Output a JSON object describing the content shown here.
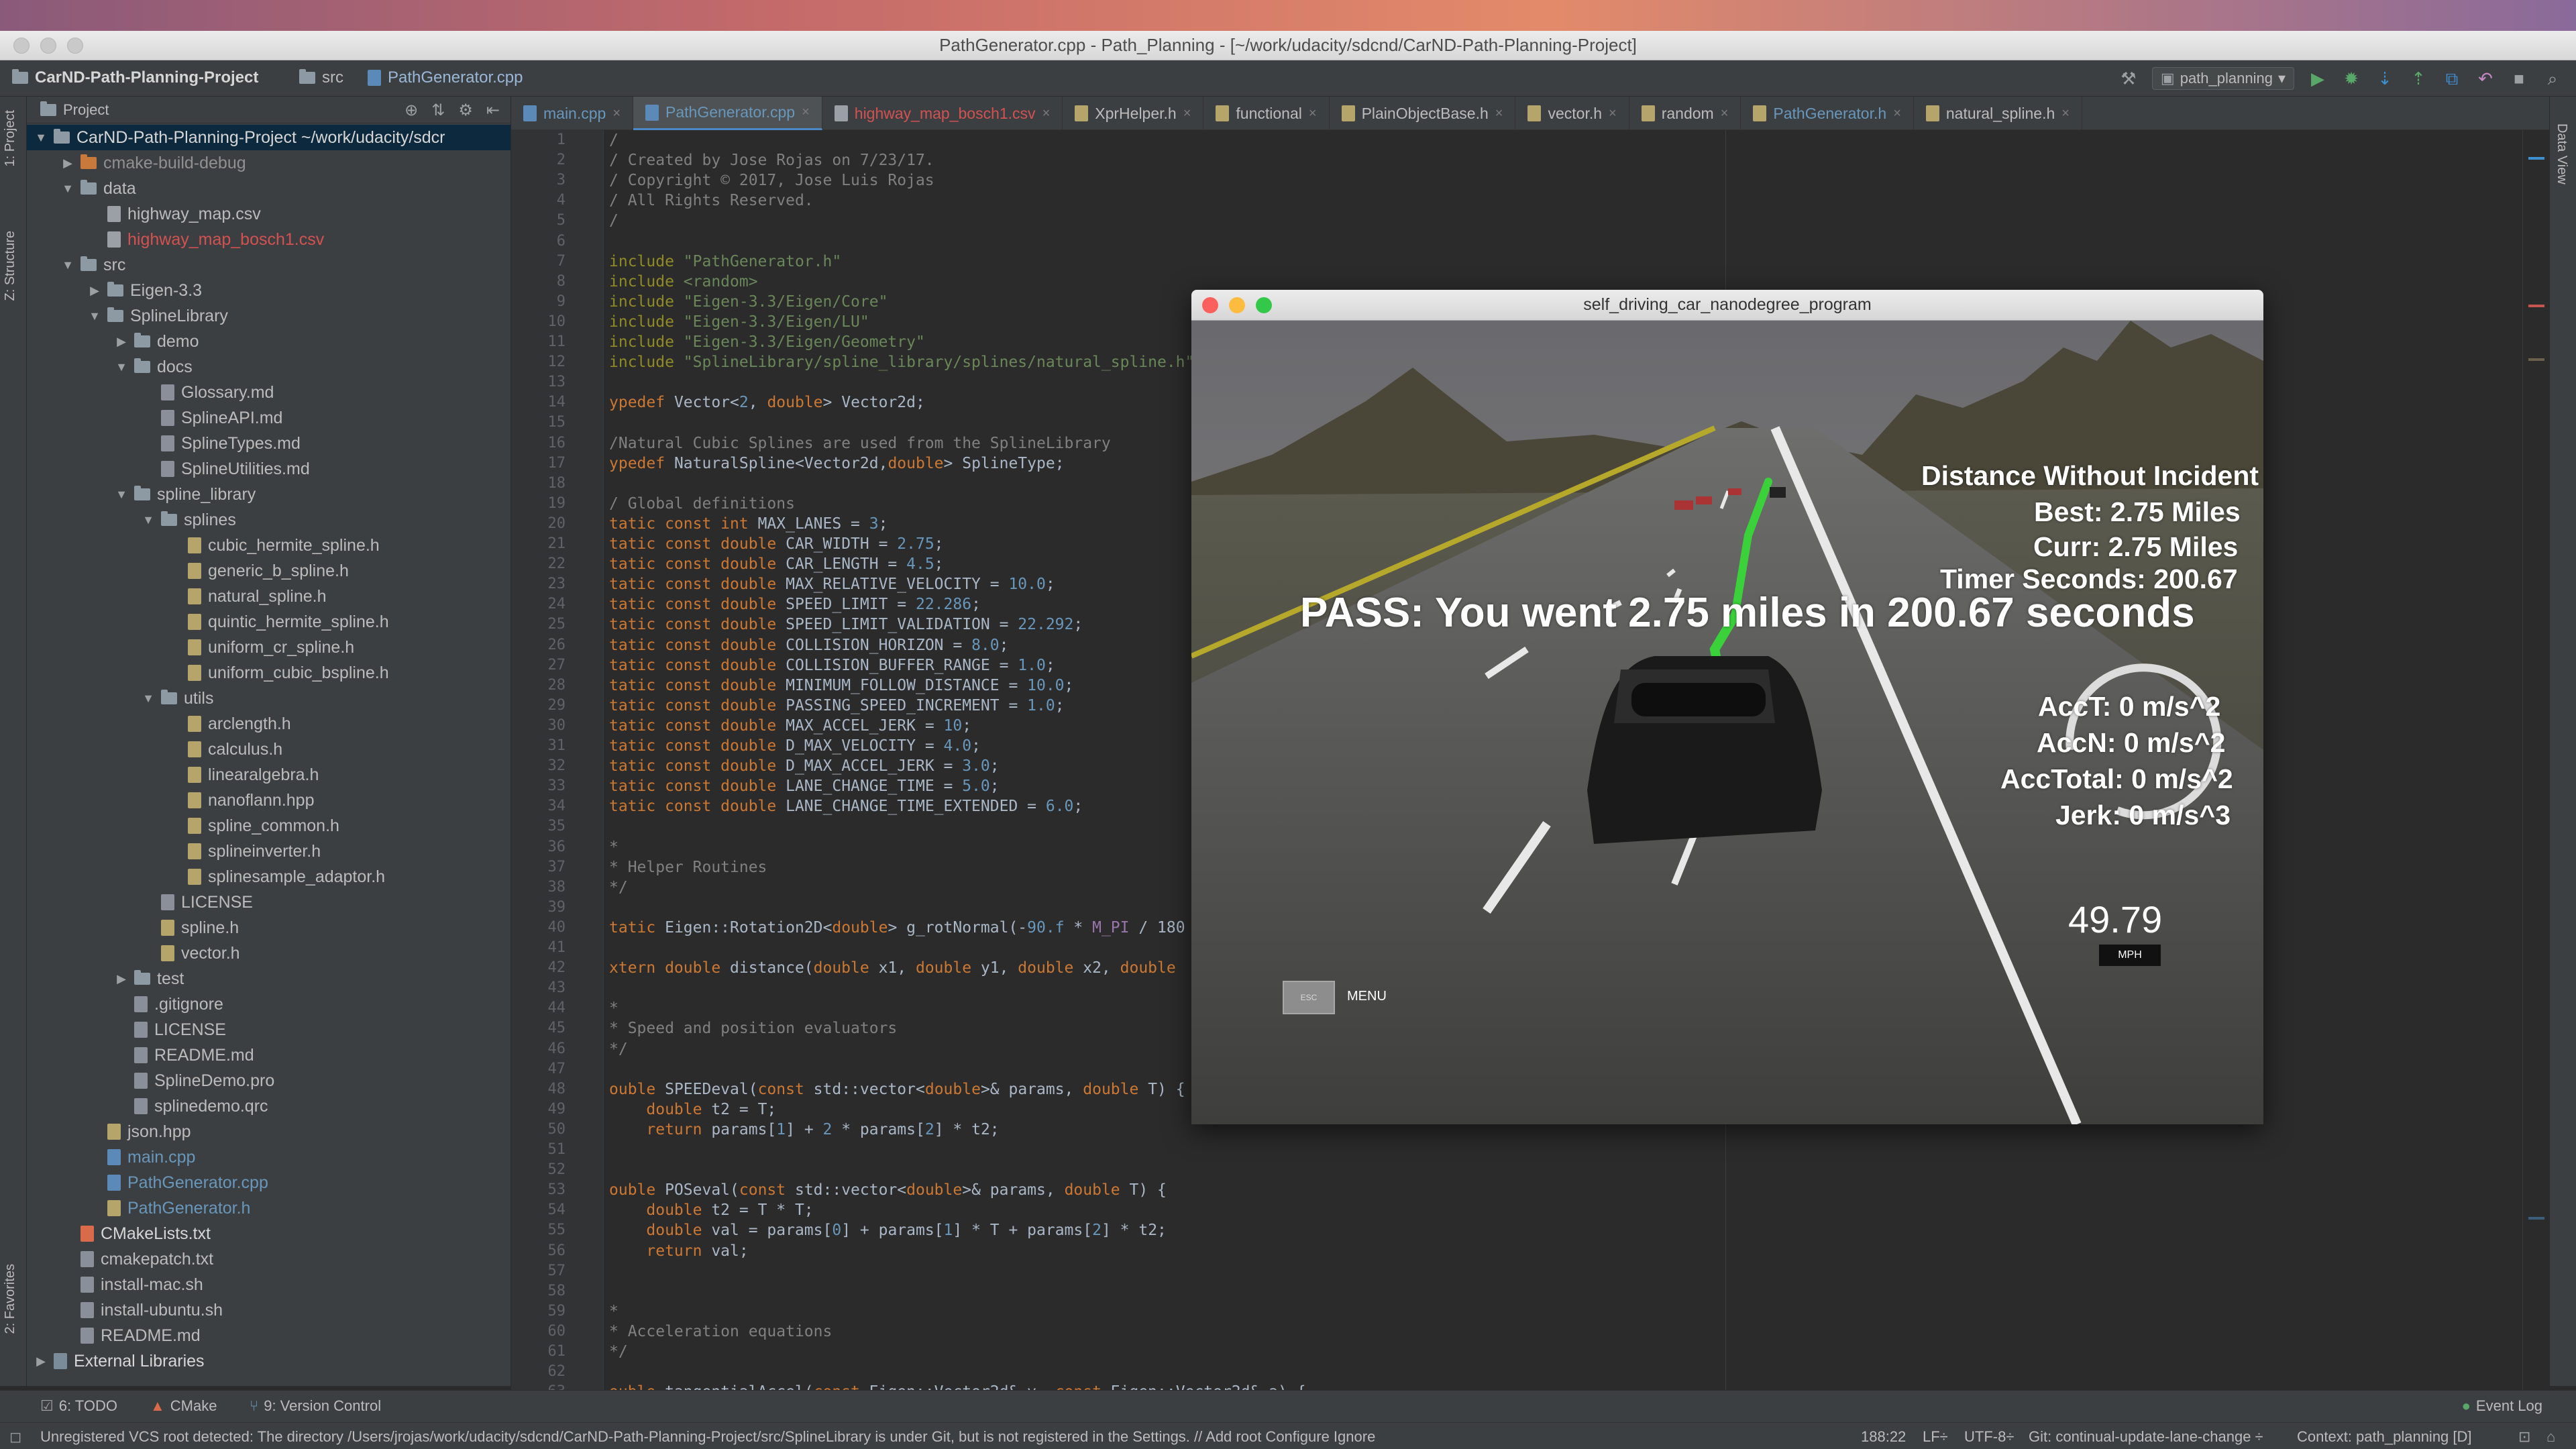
{
  "window": {
    "title": "PathGenerator.cpp - Path_Planning - [~/work/udacity/sdcnd/CarND-Path-Planning-Project]"
  },
  "navbar": {
    "crumbs": [
      "CarND-Path-Planning-Project",
      "src",
      "PathGenerator.cpp"
    ],
    "run_config": "path_planning"
  },
  "left_strip": {
    "project_tab": "1: Project",
    "structure_tab": "Z: Structure",
    "favorites_tab": "2: Favorites"
  },
  "right_strip": {
    "data_view_tab": "Data View"
  },
  "project_panel": {
    "header": "Project",
    "items": [
      {
        "label": "CarND-Path-Planning-Project   ~/work/udacity/sdcr",
        "depth": 0,
        "kind": "folder",
        "expanded": true,
        "selected": true,
        "color": "white"
      },
      {
        "label": "cmake-build-debug",
        "depth": 1,
        "kind": "folder-orange",
        "expanded": false,
        "color": "gray"
      },
      {
        "label": "data",
        "depth": 1,
        "kind": "folder",
        "expanded": true,
        "color": "normal"
      },
      {
        "label": "highway_map.csv",
        "depth": 2,
        "kind": "csv",
        "color": "normal"
      },
      {
        "label": "highway_map_bosch1.csv",
        "depth": 2,
        "kind": "csv",
        "color": "red"
      },
      {
        "label": "src",
        "depth": 1,
        "kind": "folder",
        "expanded": true,
        "color": "normal"
      },
      {
        "label": "Eigen-3.3",
        "depth": 2,
        "kind": "folder",
        "expanded": false,
        "color": "normal"
      },
      {
        "label": "SplineLibrary",
        "depth": 2,
        "kind": "folder",
        "expanded": true,
        "color": "normal"
      },
      {
        "label": "demo",
        "depth": 3,
        "kind": "folder",
        "expanded": false,
        "color": "normal"
      },
      {
        "label": "docs",
        "depth": 3,
        "kind": "folder",
        "expanded": true,
        "color": "normal"
      },
      {
        "label": "Glossary.md",
        "depth": 4,
        "kind": "md",
        "color": "normal"
      },
      {
        "label": "SplineAPI.md",
        "depth": 4,
        "kind": "md",
        "color": "normal"
      },
      {
        "label": "SplineTypes.md",
        "depth": 4,
        "kind": "md",
        "color": "normal"
      },
      {
        "label": "SplineUtilities.md",
        "depth": 4,
        "kind": "md",
        "color": "normal"
      },
      {
        "label": "spline_library",
        "depth": 3,
        "kind": "folder",
        "expanded": true,
        "color": "normal"
      },
      {
        "label": "splines",
        "depth": 4,
        "kind": "folder",
        "expanded": true,
        "color": "normal"
      },
      {
        "label": "cubic_hermite_spline.h",
        "depth": 5,
        "kind": "h",
        "color": "normal"
      },
      {
        "label": "generic_b_spline.h",
        "depth": 5,
        "kind": "h",
        "color": "normal"
      },
      {
        "label": "natural_spline.h",
        "depth": 5,
        "kind": "h",
        "color": "normal"
      },
      {
        "label": "quintic_hermite_spline.h",
        "depth": 5,
        "kind": "h",
        "color": "normal"
      },
      {
        "label": "uniform_cr_spline.h",
        "depth": 5,
        "kind": "h",
        "color": "normal"
      },
      {
        "label": "uniform_cubic_bspline.h",
        "depth": 5,
        "kind": "h",
        "color": "normal"
      },
      {
        "label": "utils",
        "depth": 4,
        "kind": "folder",
        "expanded": true,
        "color": "normal"
      },
      {
        "label": "arclength.h",
        "depth": 5,
        "kind": "h",
        "color": "normal"
      },
      {
        "label": "calculus.h",
        "depth": 5,
        "kind": "h",
        "color": "normal"
      },
      {
        "label": "linearalgebra.h",
        "depth": 5,
        "kind": "h",
        "color": "normal"
      },
      {
        "label": "nanoflann.hpp",
        "depth": 5,
        "kind": "h",
        "color": "normal"
      },
      {
        "label": "spline_common.h",
        "depth": 5,
        "kind": "h",
        "color": "normal"
      },
      {
        "label": "splineinverter.h",
        "depth": 5,
        "kind": "h",
        "color": "normal"
      },
      {
        "label": "splinesample_adaptor.h",
        "depth": 5,
        "kind": "h",
        "color": "normal"
      },
      {
        "label": "LICENSE",
        "depth": 4,
        "kind": "md",
        "color": "normal"
      },
      {
        "label": "spline.h",
        "depth": 4,
        "kind": "h",
        "color": "normal"
      },
      {
        "label": "vector.h",
        "depth": 4,
        "kind": "h",
        "color": "normal"
      },
      {
        "label": "test",
        "depth": 3,
        "kind": "folder",
        "expanded": false,
        "color": "normal"
      },
      {
        "label": ".gitignore",
        "depth": 3,
        "kind": "md",
        "color": "normal"
      },
      {
        "label": "LICENSE",
        "depth": 3,
        "kind": "md",
        "color": "normal"
      },
      {
        "label": "README.md",
        "depth": 3,
        "kind": "md",
        "color": "normal"
      },
      {
        "label": "SplineDemo.pro",
        "depth": 3,
        "kind": "md",
        "color": "normal"
      },
      {
        "label": "splinedemo.qrc",
        "depth": 3,
        "kind": "md",
        "color": "normal"
      },
      {
        "label": "json.hpp",
        "depth": 2,
        "kind": "h",
        "color": "normal"
      },
      {
        "label": "main.cpp",
        "depth": 2,
        "kind": "cpp",
        "color": "blue"
      },
      {
        "label": "PathGenerator.cpp",
        "depth": 2,
        "kind": "cpp",
        "color": "blue"
      },
      {
        "label": "PathGenerator.h",
        "depth": 2,
        "kind": "h",
        "color": "blue"
      },
      {
        "label": "CMakeLists.txt",
        "depth": 1,
        "kind": "cmake",
        "color": "white"
      },
      {
        "label": "cmakepatch.txt",
        "depth": 1,
        "kind": "md",
        "color": "normal"
      },
      {
        "label": "install-mac.sh",
        "depth": 1,
        "kind": "md",
        "color": "normal"
      },
      {
        "label": "install-ubuntu.sh",
        "depth": 1,
        "kind": "md",
        "color": "normal"
      },
      {
        "label": "README.md",
        "depth": 1,
        "kind": "md",
        "color": "normal"
      },
      {
        "label": "External Libraries",
        "depth": 0,
        "kind": "lib",
        "expanded": false,
        "color": "white"
      }
    ]
  },
  "editor_tabs": [
    {
      "label": "main.cpp",
      "style": "blue",
      "icon": "cpp"
    },
    {
      "label": "PathGenerator.cpp",
      "style": "blue",
      "icon": "cpp",
      "active": true
    },
    {
      "label": "highway_map_bosch1.csv",
      "style": "csv-red",
      "icon": "csv"
    },
    {
      "label": "XprHelper.h",
      "style": "",
      "icon": "h"
    },
    {
      "label": "functional",
      "style": "",
      "icon": "h"
    },
    {
      "label": "PlainObjectBase.h",
      "style": "",
      "icon": "h"
    },
    {
      "label": "vector.h",
      "style": "",
      "icon": "h"
    },
    {
      "label": "random",
      "style": "",
      "icon": "h"
    },
    {
      "label": "PathGenerator.h",
      "style": "blue",
      "icon": "h"
    },
    {
      "label": "natural_spline.h",
      "style": "",
      "icon": "h"
    }
  ],
  "code_lines": [
    [
      [
        "cm",
        "/"
      ]
    ],
    [
      [
        "cm",
        "/ Created by Jose Rojas on 7/23/17."
      ]
    ],
    [
      [
        "cm",
        "/ Copyright © 2017, Jose Luis Rojas"
      ]
    ],
    [
      [
        "cm",
        "/ All Rights Reserved."
      ]
    ],
    [
      [
        "cm",
        "/"
      ]
    ],
    [],
    [
      [
        "mac",
        "include "
      ],
      [
        "str",
        "\"PathGenerator.h\""
      ]
    ],
    [
      [
        "mac",
        "include "
      ],
      [
        "str",
        "<random>"
      ]
    ],
    [
      [
        "mac",
        "include "
      ],
      [
        "str",
        "\"Eigen-3.3/Eigen/Core\""
      ]
    ],
    [
      [
        "mac",
        "include "
      ],
      [
        "str",
        "\"Eigen-3.3/Eigen/LU\""
      ]
    ],
    [
      [
        "mac",
        "include "
      ],
      [
        "str",
        "\"Eigen-3.3/Eigen/Geometry\""
      ]
    ],
    [
      [
        "mac",
        "include "
      ],
      [
        "str",
        "\"SplineLibrary/spline_library/splines/natural_spline.h\""
      ]
    ],
    [],
    [
      [
        "kw",
        "ypedef "
      ],
      [
        "",
        "Vector<"
      ],
      [
        "num",
        "2"
      ],
      [
        "",
        ", "
      ],
      [
        "kw",
        "double"
      ],
      [
        "",
        "> Vector2d;"
      ]
    ],
    [],
    [
      [
        "cm",
        "/Natural Cubic Splines are used from the SplineLibrary"
      ]
    ],
    [
      [
        "kw",
        "ypedef "
      ],
      [
        "",
        "NaturalSpline<Vector2d,"
      ],
      [
        "kw",
        "double"
      ],
      [
        "",
        "> SplineType;"
      ]
    ],
    [],
    [
      [
        "cm",
        "/ Global definitions"
      ]
    ],
    [
      [
        "kw",
        "tatic const int "
      ],
      [
        "",
        "MAX_LANES = "
      ],
      [
        "num",
        "3"
      ],
      [
        "",
        ";"
      ]
    ],
    [
      [
        "kw",
        "tatic const double "
      ],
      [
        "",
        "CAR_WIDTH = "
      ],
      [
        "num",
        "2.75"
      ],
      [
        "",
        ";"
      ]
    ],
    [
      [
        "kw",
        "tatic const double "
      ],
      [
        "",
        "CAR_LENGTH = "
      ],
      [
        "num",
        "4.5"
      ],
      [
        "",
        ";"
      ]
    ],
    [
      [
        "kw",
        "tatic const double "
      ],
      [
        "",
        "MAX_RELATIVE_VELOCITY = "
      ],
      [
        "num",
        "10.0"
      ],
      [
        "",
        ";"
      ]
    ],
    [
      [
        "kw",
        "tatic const double "
      ],
      [
        "",
        "SPEED_LIMIT = "
      ],
      [
        "num",
        "22.286"
      ],
      [
        "",
        ";"
      ]
    ],
    [
      [
        "kw",
        "tatic const double "
      ],
      [
        "",
        "SPEED_LIMIT_VALIDATION = "
      ],
      [
        "num",
        "22.292"
      ],
      [
        "",
        ";"
      ]
    ],
    [
      [
        "kw",
        "tatic const double "
      ],
      [
        "",
        "COLLISION_HORIZON = "
      ],
      [
        "num",
        "8.0"
      ],
      [
        "",
        ";"
      ]
    ],
    [
      [
        "kw",
        "tatic const double "
      ],
      [
        "",
        "COLLISION_BUFFER_RANGE = "
      ],
      [
        "num",
        "1.0"
      ],
      [
        "",
        ";"
      ]
    ],
    [
      [
        "kw",
        "tatic const double "
      ],
      [
        "",
        "MINIMUM_FOLLOW_DISTANCE = "
      ],
      [
        "num",
        "10.0"
      ],
      [
        "",
        ";"
      ]
    ],
    [
      [
        "kw",
        "tatic const double "
      ],
      [
        "",
        "PASSING_SPEED_INCREMENT = "
      ],
      [
        "num",
        "1.0"
      ],
      [
        "",
        ";"
      ]
    ],
    [
      [
        "kw",
        "tatic const double "
      ],
      [
        "",
        "MAX_ACCEL_JERK = "
      ],
      [
        "num",
        "10"
      ],
      [
        "",
        ";"
      ]
    ],
    [
      [
        "kw",
        "tatic const double "
      ],
      [
        "",
        "D_MAX_VELOCITY = "
      ],
      [
        "num",
        "4.0"
      ],
      [
        "",
        ";"
      ]
    ],
    [
      [
        "kw",
        "tatic const double "
      ],
      [
        "",
        "D_MAX_ACCEL_JERK = "
      ],
      [
        "num",
        "3.0"
      ],
      [
        "",
        ";"
      ]
    ],
    [
      [
        "kw",
        "tatic const double "
      ],
      [
        "",
        "LANE_CHANGE_TIME = "
      ],
      [
        "num",
        "5.0"
      ],
      [
        "",
        ";"
      ]
    ],
    [
      [
        "kw",
        "tatic const double "
      ],
      [
        "",
        "LANE_CHANGE_TIME_EXTENDED = "
      ],
      [
        "num",
        "6.0"
      ],
      [
        "",
        ";"
      ]
    ],
    [],
    [
      [
        "cm",
        "*"
      ]
    ],
    [
      [
        "cm",
        "* Helper Routines"
      ]
    ],
    [
      [
        "cm",
        "*/"
      ]
    ],
    [],
    [
      [
        "kw",
        "tatic "
      ],
      [
        "",
        "Eigen::Rotation2D<"
      ],
      [
        "kw",
        "double"
      ],
      [
        "",
        "> g_rotNormal(-"
      ],
      [
        "num",
        "90.f"
      ],
      [
        "",
        " * "
      ],
      [
        "fld",
        "M_PI"
      ],
      [
        "",
        " / 180"
      ]
    ],
    [],
    [
      [
        "kw",
        "xtern double "
      ],
      [
        "",
        "distance("
      ],
      [
        "kw",
        "double "
      ],
      [
        "",
        "x1, "
      ],
      [
        "kw",
        "double "
      ],
      [
        "",
        "y1, "
      ],
      [
        "kw",
        "double "
      ],
      [
        "",
        "x2, "
      ],
      [
        "kw",
        "double"
      ]
    ],
    [],
    [
      [
        "cm",
        "*"
      ]
    ],
    [
      [
        "cm",
        "* Speed and position evaluators"
      ]
    ],
    [
      [
        "cm",
        "*/"
      ]
    ],
    [],
    [
      [
        "kw",
        "ouble "
      ],
      [
        "",
        "SPEEDeval("
      ],
      [
        "kw",
        "const "
      ],
      [
        "",
        "std::vector<"
      ],
      [
        "kw",
        "double"
      ],
      [
        "",
        ">& params, "
      ],
      [
        "kw",
        "double "
      ],
      [
        "",
        "T) {"
      ]
    ],
    [
      [
        "",
        "    "
      ],
      [
        "kw",
        "double "
      ],
      [
        "",
        "t2 = T;"
      ]
    ],
    [
      [
        "",
        "    "
      ],
      [
        "kw",
        "return "
      ],
      [
        "",
        "params["
      ],
      [
        "num",
        "1"
      ],
      [
        "",
        "] + "
      ],
      [
        "num",
        "2"
      ],
      [
        "",
        " * params["
      ],
      [
        "num",
        "2"
      ],
      [
        "",
        "] * t2;"
      ]
    ],
    [],
    [],
    [
      [
        "kw",
        "ouble "
      ],
      [
        "",
        "POSeval("
      ],
      [
        "kw",
        "const "
      ],
      [
        "",
        "std::vector<"
      ],
      [
        "kw",
        "double"
      ],
      [
        "",
        ">& params, "
      ],
      [
        "kw",
        "double "
      ],
      [
        "",
        "T) {"
      ]
    ],
    [
      [
        "",
        "    "
      ],
      [
        "kw",
        "double "
      ],
      [
        "",
        "t2 = T * T;"
      ]
    ],
    [
      [
        "",
        "    "
      ],
      [
        "kw",
        "double "
      ],
      [
        "",
        "val = params["
      ],
      [
        "num",
        "0"
      ],
      [
        "",
        "] + params["
      ],
      [
        "num",
        "1"
      ],
      [
        "",
        "] * T + params["
      ],
      [
        "num",
        "2"
      ],
      [
        "",
        "] * t2;"
      ]
    ],
    [
      [
        "",
        "    "
      ],
      [
        "kw",
        "return "
      ],
      [
        "",
        "val;"
      ]
    ],
    [],
    [],
    [
      [
        "cm",
        "*"
      ]
    ],
    [
      [
        "cm",
        "* Acceleration equations"
      ]
    ],
    [
      [
        "cm",
        "*/"
      ]
    ],
    [],
    [
      [
        "kw",
        "ouble "
      ],
      [
        "",
        "tangentialAccel("
      ],
      [
        "kw",
        "const "
      ],
      [
        "",
        "Eigen::Vector2d& v, "
      ],
      [
        "kw",
        "const "
      ],
      [
        "",
        "Eigen::Vector2d& a) {"
      ]
    ]
  ],
  "simulator": {
    "title": "self_driving_car_nanodegree_program",
    "distance_heading": "Distance Without Incident",
    "best": "Best: 2.75 Miles",
    "curr": "Curr: 2.75 Miles",
    "timer": "Timer Seconds: 200.67",
    "pass_message": "PASS: You went 2.75 miles in 200.67 seconds",
    "acct": "AccT: 0 m/s^2",
    "accn": "AccN: 0 m/s^2",
    "acctotal": "AccTotal: 0 m/s^2",
    "jerk": "Jerk: 0 m/s^3",
    "speed": "49.79",
    "speed_unit": "MPH",
    "speed_fraction": 0.5,
    "esc_label": "ESC",
    "menu_label": "MENU"
  },
  "tool_windows": {
    "todo": "6: TODO",
    "cmake": "CMake",
    "vcs": "9: Version Control",
    "event_log": "Event Log"
  },
  "status_bar": {
    "message": "Unregistered VCS root detected: The directory /Users/jrojas/work/udacity/sdcnd/CarND-Path-Planning-Project/src/SplineLibrary is under Git, but is not registered in the Settings. // Add root  Configure  Ignore",
    "position": "188:22",
    "line_sep": "LF÷",
    "encoding": "UTF-8÷",
    "git_branch": "Git: continual-update-lane-change ÷",
    "context": "Context: path_planning [D]"
  },
  "colors": {
    "accent": "#4a88c7",
    "pass_green": "#3bd13b"
  }
}
